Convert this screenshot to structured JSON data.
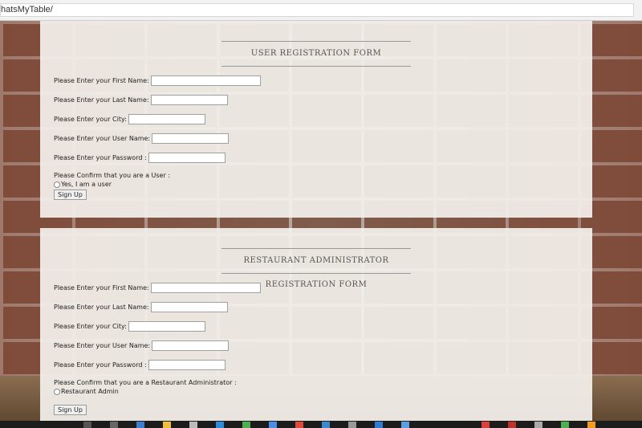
{
  "browser": {
    "url": "hatsMyTable/"
  },
  "user_form": {
    "title": "USER REGISTRATION FORM",
    "first_name_label": "Please Enter your First Name:",
    "last_name_label": "Please Enter your Last Name:",
    "city_label": "Please Enter your City:",
    "username_label": "Please Enter your User Name:",
    "password_label": "Please Enter your Password :",
    "confirm_text": "Please Confirm that you are a User :",
    "radio_label": "Yes, I am a user",
    "submit_label": "Sign Up"
  },
  "admin_form": {
    "title": "RESTAURANT ADMINISTRATOR REGISTRATION FORM",
    "first_name_label": "Please Enter your First Name:",
    "last_name_label": "Please Enter your Last Name:",
    "city_label": "Please Enter your City:",
    "username_label": "Please Enter your User Name:",
    "password_label": "Please Enter your Password :",
    "confirm_text": "Please Confirm that you are a Restaurant Administrator :",
    "radio_label": "Restaurant Admin",
    "submit_label": "Sign Up"
  },
  "taskbar": {
    "icons": [
      "search-icon",
      "task-view-icon",
      "edge-icon",
      "file-explorer-icon",
      "store-icon",
      "dropbox-icon",
      "app-icon",
      "chrome-icon",
      "app-icon",
      "app-icon",
      "app-icon",
      "app-icon",
      "app-icon",
      "chrome-icon",
      "app-icon",
      "app-icon",
      "app-icon",
      "app-icon"
    ],
    "colors": [
      "#3c7fd0",
      "#f2c037",
      "#2a8de0",
      "#4caf50",
      "#e04a3a",
      "#f29c1f"
    ]
  }
}
